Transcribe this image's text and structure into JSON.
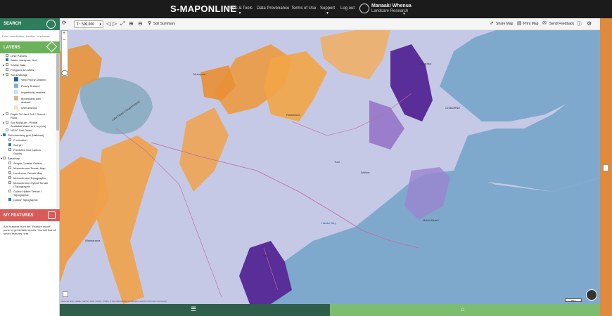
{
  "header": {
    "brand": "S-MAPONLINE",
    "nav": [
      "Maps & Tools",
      "Data Provenance",
      "Terms of Use",
      "Support",
      "Log out"
    ],
    "org_line1": "Manaaki Whenua",
    "org_line2": "Landcare Research"
  },
  "search": {
    "title": "SEARCH",
    "placeholder": "Enter coordinates, location or address"
  },
  "layers": {
    "title": "LAYERS",
    "items": [
      {
        "label": "LINZ Parcels",
        "checked": false
      },
      {
        "label": "Water, transport, text",
        "checked": true
      },
      {
        "label": "S-Map Data",
        "checked": false
      },
      {
        "label": "Polygons & Labels",
        "checked": false
      },
      {
        "label": "Soil Drainage",
        "checked": false
      },
      {
        "label": "Very Poorly Drained",
        "swatch": "#1d5fa8"
      },
      {
        "label": "Poorly Drained",
        "swatch": "#7fb1e0"
      },
      {
        "label": "Imperfectly drained",
        "swatch": "#cfe2f5"
      },
      {
        "label": "Moderately well",
        "swatch": "#d6b48a"
      },
      {
        "label": "drained",
        "swatch": ""
      },
      {
        "label": "Well drained",
        "swatch": "#f1e2c4"
      },
      {
        "label": "Depth To Hard Soil / Gravel /",
        "checked": false
      },
      {
        "label": "Rock",
        "checked": false
      },
      {
        "label": "Soil Moisture - Profile",
        "checked": false
      },
      {
        "label": "Available Water in 1 m (mm)",
        "checked": false
      },
      {
        "label": "NZSC Soil Order",
        "checked": false
      },
      {
        "label": "Soil chemistry grid (National)",
        "checked": true
      },
      {
        "label": "P-retention",
        "checked": false
      },
      {
        "label": "Soil pH",
        "checked": true
      },
      {
        "label": "Predicted Soil Carbon",
        "checked": false
      },
      {
        "label": "Stocks",
        "checked": false
      },
      {
        "label": "Basemap",
        "checked": false
      },
      {
        "label": "Simple Coastal Outline",
        "checked": false
      },
      {
        "label": "Monochrome Terrain Map",
        "checked": false
      },
      {
        "label": "Landcover Terrain Map",
        "checked": false
      },
      {
        "label": "Monochrome Topographic",
        "checked": false
      },
      {
        "label": "Monochrome Hybrid Terrain",
        "checked": false
      },
      {
        "label": "/ Topographic",
        "checked": false
      },
      {
        "label": "Colour Hybrid Terrain /",
        "checked": false
      },
      {
        "label": "Topographic",
        "checked": false
      },
      {
        "label": "Colour Topographic",
        "checked": true
      }
    ]
  },
  "features": {
    "title": "MY FEATURES",
    "text": "Add features from the \"Feature report\" pane to get details reports. You will find all saved features here."
  },
  "toolbar": {
    "scale": "1 : 500,000",
    "soil_summary": "Soil Summary",
    "share": "Share Map",
    "print": "Print Map",
    "feedback": "Send Feedback"
  },
  "map": {
    "labels": [
      {
        "text": "Lake Taupō (Taupomoana)",
        "sea": false
      },
      {
        "text": "Hawke Bay",
        "sea": true
      },
      {
        "text": "GISBORNE",
        "sea": false
      },
      {
        "text": "Napier",
        "sea": false
      },
      {
        "text": "Wairoa",
        "sea": false
      },
      {
        "text": "Mahia Beach",
        "sea": false
      },
      {
        "text": "Te Karaka",
        "sea": false
      },
      {
        "text": "Ruatahuna",
        "sea": false
      },
      {
        "text": "Murupara",
        "sea": false
      },
      {
        "text": "Tuai",
        "sea": false
      },
      {
        "text": "Waimarama",
        "sea": false
      }
    ],
    "attribution": "Sources: Esri, HERE, Garmin, FAO, NOAA, USGS, © OpenStreetMap contributors, and the GIS User Community",
    "scalebar": "10km"
  },
  "colors": {
    "header_bg": "#1b1b1b",
    "search_green": "#2e7d5b",
    "layers_green": "#6cb25b",
    "features_red": "#d95b58",
    "right_strip": "#e08a3d",
    "ocean": "#7fa9cc",
    "land_purple": "#b9a7d8",
    "acid_orange": "#e89a3c",
    "alkaline_purple": "#5a2e98"
  },
  "icons": [
    "search-icon",
    "layers-icon",
    "features-icon",
    "refresh-icon",
    "fullscreen-icon",
    "globe-icon",
    "zoom-icon",
    "share-icon",
    "print-icon",
    "feedback-icon",
    "help-icon",
    "gear-icon",
    "list-icon",
    "tag-icon",
    "compass-icon"
  ]
}
